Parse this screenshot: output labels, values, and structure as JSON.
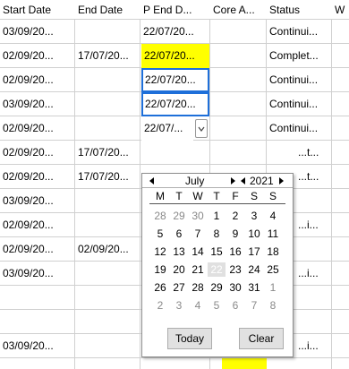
{
  "columns": [
    {
      "label": "Start Date"
    },
    {
      "label": "End Date"
    },
    {
      "label": "P End D..."
    },
    {
      "label": "Core A..."
    },
    {
      "label": "Status"
    },
    {
      "label": "W"
    }
  ],
  "rows": [
    {
      "start": "03/09/20...",
      "end": "",
      "pend": "22/07/20...",
      "status": "Continui..."
    },
    {
      "start": "02/09/20...",
      "end": "17/07/20...",
      "pend": "22/07/20...",
      "status": "Complet..."
    },
    {
      "start": "02/09/20...",
      "end": "",
      "pend": "22/07/20...",
      "status": "Continui..."
    },
    {
      "start": "03/09/20...",
      "end": "",
      "pend": "22/07/20...",
      "status": "Continui..."
    },
    {
      "start": "02/09/20...",
      "end": "",
      "pend": "22/07/...",
      "status": "Continui..."
    },
    {
      "start": "02/09/20...",
      "end": "17/07/20...",
      "pend": "",
      "status": "...t..."
    },
    {
      "start": "02/09/20...",
      "end": "17/07/20...",
      "pend": "",
      "status": "...t..."
    },
    {
      "start": "03/09/20...",
      "end": "",
      "pend": "",
      "status": ""
    },
    {
      "start": "02/09/20...",
      "end": "",
      "pend": "",
      "status": "...i..."
    },
    {
      "start": "02/09/20...",
      "end": "02/09/20...",
      "pend": "",
      "status": ""
    },
    {
      "start": "03/09/20...",
      "end": "",
      "pend": "",
      "status": "...i..."
    },
    {
      "start": "03/09/20...",
      "end": "",
      "pend": "",
      "status": "...i..."
    }
  ],
  "calendar": {
    "month": "July",
    "year": "2021",
    "weekdays": [
      "M",
      "T",
      "W",
      "T",
      "F",
      "S",
      "S"
    ],
    "weeks": [
      [
        "28",
        "29",
        "30",
        "1",
        "2",
        "3",
        "4"
      ],
      [
        "5",
        "6",
        "7",
        "8",
        "9",
        "10",
        "11"
      ],
      [
        "12",
        "13",
        "14",
        "15",
        "16",
        "17",
        "18"
      ],
      [
        "19",
        "20",
        "21",
        "22",
        "23",
        "24",
        "25"
      ],
      [
        "26",
        "27",
        "28",
        "29",
        "30",
        "31",
        "1"
      ],
      [
        "2",
        "3",
        "4",
        "5",
        "6",
        "7",
        "8"
      ]
    ],
    "today_label": "Today",
    "clear_label": "Clear"
  },
  "colors": {
    "highlight": "#ffff00",
    "focus_border": "#1e6fd9",
    "grid_line": "#d0d0d0"
  }
}
